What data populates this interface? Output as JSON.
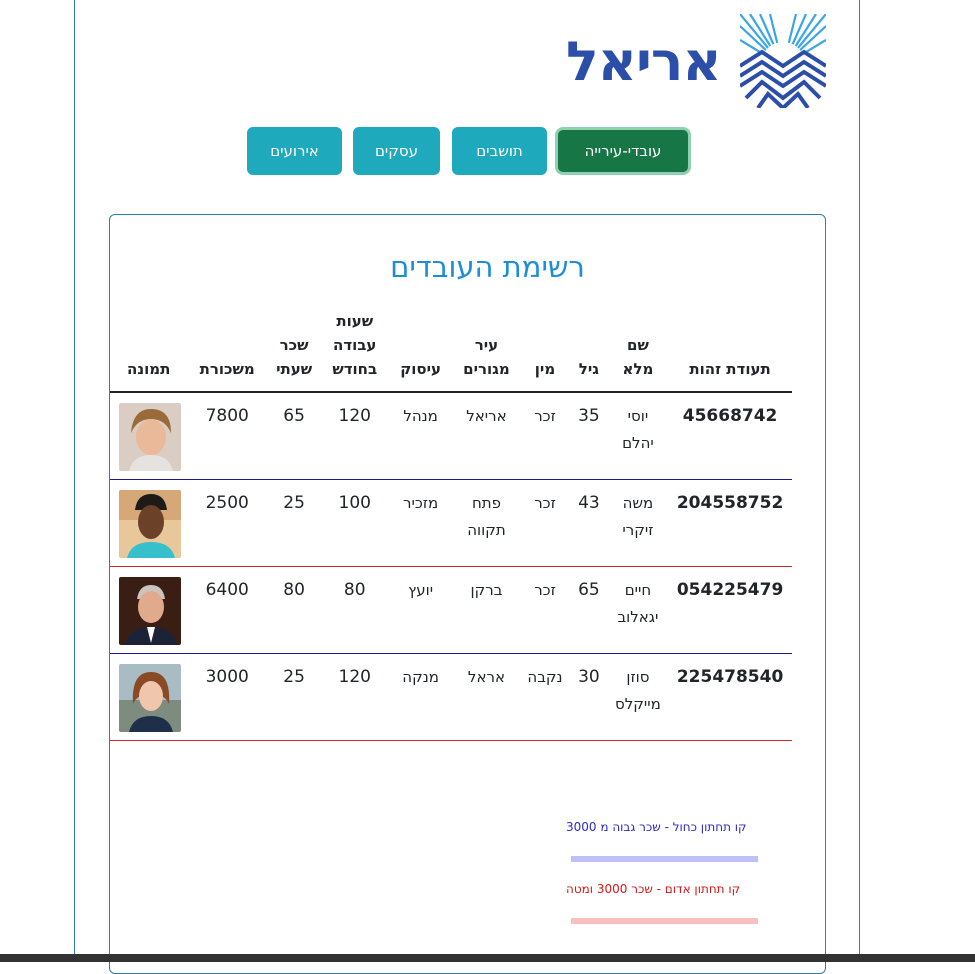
{
  "brand": {
    "name": "אריאל"
  },
  "nav": [
    {
      "label": "עובדי-עירייה",
      "active": true
    },
    {
      "label": "תושבים",
      "active": false
    },
    {
      "label": "עסקים",
      "active": false
    },
    {
      "label": "אירועים",
      "active": false
    }
  ],
  "card": {
    "title": "רשימת העובדים"
  },
  "table": {
    "headers": {
      "id": "תעודת זהות",
      "name": "שם מלא",
      "age": "גיל",
      "gender": "מין",
      "city": "עיר מגורים",
      "job": "עיסוק",
      "hours": "שעות עבודה בחודש",
      "rate": "שכר שעתי",
      "salary": "משכורת",
      "photo": "תמונה"
    },
    "rows": [
      {
        "id": "45668742",
        "name": "יוסי יהלם",
        "age": "35",
        "gender": "זכר",
        "city": "אריאל",
        "job": "מנהל",
        "hours": "120",
        "rate": "65",
        "salary": "7800",
        "photo_icon": "young-man-portrait",
        "line": "blue"
      },
      {
        "id": "204558752",
        "name": "משה זיקרי",
        "age": "43",
        "gender": "זכר",
        "city": "פתח תקווה",
        "job": "מזכיר",
        "hours": "100",
        "rate": "25",
        "salary": "2500",
        "photo_icon": "man-portrait",
        "line": "red"
      },
      {
        "id": "054225479",
        "name": "חיים יגאלוב",
        "age": "65",
        "gender": "זכר",
        "city": "ברקן",
        "job": "יועץ",
        "hours": "80",
        "rate": "80",
        "salary": "6400",
        "photo_icon": "older-man-portrait",
        "line": "blue"
      },
      {
        "id": "225478540",
        "name": "סוזן מייקלס",
        "age": "30",
        "gender": "נקבה",
        "city": "אראל",
        "job": "מנקה",
        "hours": "120",
        "rate": "25",
        "salary": "3000",
        "photo_icon": "woman-portrait",
        "line": "red"
      }
    ]
  },
  "legend": {
    "blue": "קו תחתון כחול - שכר גבוה מ 3000",
    "red": "קו תחתון אדום - שכר 3000 ומטה"
  },
  "colors": {
    "nav_button": "#1eaabc",
    "nav_active": "#177646",
    "title": "#1c8ed8",
    "logo": "#2b4fa9",
    "line_blue": "#1a1a8c",
    "line_red": "#cc2a2a"
  }
}
